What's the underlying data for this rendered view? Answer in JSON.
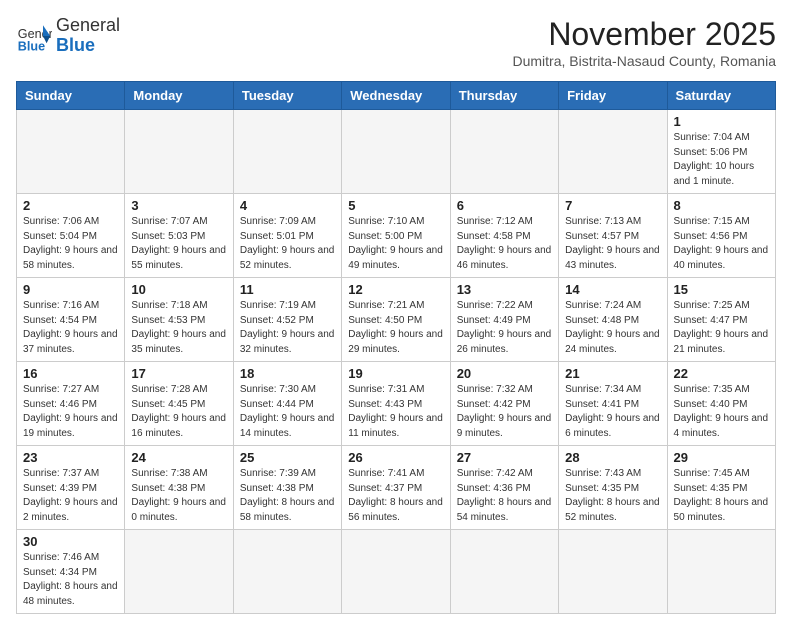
{
  "logo": {
    "general": "General",
    "blue": "Blue"
  },
  "title": "November 2025",
  "subtitle": "Dumitra, Bistrita-Nasaud County, Romania",
  "weekdays": [
    "Sunday",
    "Monday",
    "Tuesday",
    "Wednesday",
    "Thursday",
    "Friday",
    "Saturday"
  ],
  "weeks": [
    [
      {
        "day": "",
        "info": ""
      },
      {
        "day": "",
        "info": ""
      },
      {
        "day": "",
        "info": ""
      },
      {
        "day": "",
        "info": ""
      },
      {
        "day": "",
        "info": ""
      },
      {
        "day": "",
        "info": ""
      },
      {
        "day": "1",
        "info": "Sunrise: 7:04 AM\nSunset: 5:06 PM\nDaylight: 10 hours\nand 1 minute."
      }
    ],
    [
      {
        "day": "2",
        "info": "Sunrise: 7:06 AM\nSunset: 5:04 PM\nDaylight: 9 hours\nand 58 minutes."
      },
      {
        "day": "3",
        "info": "Sunrise: 7:07 AM\nSunset: 5:03 PM\nDaylight: 9 hours\nand 55 minutes."
      },
      {
        "day": "4",
        "info": "Sunrise: 7:09 AM\nSunset: 5:01 PM\nDaylight: 9 hours\nand 52 minutes."
      },
      {
        "day": "5",
        "info": "Sunrise: 7:10 AM\nSunset: 5:00 PM\nDaylight: 9 hours\nand 49 minutes."
      },
      {
        "day": "6",
        "info": "Sunrise: 7:12 AM\nSunset: 4:58 PM\nDaylight: 9 hours\nand 46 minutes."
      },
      {
        "day": "7",
        "info": "Sunrise: 7:13 AM\nSunset: 4:57 PM\nDaylight: 9 hours\nand 43 minutes."
      },
      {
        "day": "8",
        "info": "Sunrise: 7:15 AM\nSunset: 4:56 PM\nDaylight: 9 hours\nand 40 minutes."
      }
    ],
    [
      {
        "day": "9",
        "info": "Sunrise: 7:16 AM\nSunset: 4:54 PM\nDaylight: 9 hours\nand 37 minutes."
      },
      {
        "day": "10",
        "info": "Sunrise: 7:18 AM\nSunset: 4:53 PM\nDaylight: 9 hours\nand 35 minutes."
      },
      {
        "day": "11",
        "info": "Sunrise: 7:19 AM\nSunset: 4:52 PM\nDaylight: 9 hours\nand 32 minutes."
      },
      {
        "day": "12",
        "info": "Sunrise: 7:21 AM\nSunset: 4:50 PM\nDaylight: 9 hours\nand 29 minutes."
      },
      {
        "day": "13",
        "info": "Sunrise: 7:22 AM\nSunset: 4:49 PM\nDaylight: 9 hours\nand 26 minutes."
      },
      {
        "day": "14",
        "info": "Sunrise: 7:24 AM\nSunset: 4:48 PM\nDaylight: 9 hours\nand 24 minutes."
      },
      {
        "day": "15",
        "info": "Sunrise: 7:25 AM\nSunset: 4:47 PM\nDaylight: 9 hours\nand 21 minutes."
      }
    ],
    [
      {
        "day": "16",
        "info": "Sunrise: 7:27 AM\nSunset: 4:46 PM\nDaylight: 9 hours\nand 19 minutes."
      },
      {
        "day": "17",
        "info": "Sunrise: 7:28 AM\nSunset: 4:45 PM\nDaylight: 9 hours\nand 16 minutes."
      },
      {
        "day": "18",
        "info": "Sunrise: 7:30 AM\nSunset: 4:44 PM\nDaylight: 9 hours\nand 14 minutes."
      },
      {
        "day": "19",
        "info": "Sunrise: 7:31 AM\nSunset: 4:43 PM\nDaylight: 9 hours\nand 11 minutes."
      },
      {
        "day": "20",
        "info": "Sunrise: 7:32 AM\nSunset: 4:42 PM\nDaylight: 9 hours\nand 9 minutes."
      },
      {
        "day": "21",
        "info": "Sunrise: 7:34 AM\nSunset: 4:41 PM\nDaylight: 9 hours\nand 6 minutes."
      },
      {
        "day": "22",
        "info": "Sunrise: 7:35 AM\nSunset: 4:40 PM\nDaylight: 9 hours\nand 4 minutes."
      }
    ],
    [
      {
        "day": "23",
        "info": "Sunrise: 7:37 AM\nSunset: 4:39 PM\nDaylight: 9 hours\nand 2 minutes."
      },
      {
        "day": "24",
        "info": "Sunrise: 7:38 AM\nSunset: 4:38 PM\nDaylight: 9 hours\nand 0 minutes."
      },
      {
        "day": "25",
        "info": "Sunrise: 7:39 AM\nSunset: 4:38 PM\nDaylight: 8 hours\nand 58 minutes."
      },
      {
        "day": "26",
        "info": "Sunrise: 7:41 AM\nSunset: 4:37 PM\nDaylight: 8 hours\nand 56 minutes."
      },
      {
        "day": "27",
        "info": "Sunrise: 7:42 AM\nSunset: 4:36 PM\nDaylight: 8 hours\nand 54 minutes."
      },
      {
        "day": "28",
        "info": "Sunrise: 7:43 AM\nSunset: 4:35 PM\nDaylight: 8 hours\nand 52 minutes."
      },
      {
        "day": "29",
        "info": "Sunrise: 7:45 AM\nSunset: 4:35 PM\nDaylight: 8 hours\nand 50 minutes."
      }
    ],
    [
      {
        "day": "30",
        "info": "Sunrise: 7:46 AM\nSunset: 4:34 PM\nDaylight: 8 hours\nand 48 minutes."
      },
      {
        "day": "",
        "info": ""
      },
      {
        "day": "",
        "info": ""
      },
      {
        "day": "",
        "info": ""
      },
      {
        "day": "",
        "info": ""
      },
      {
        "day": "",
        "info": ""
      },
      {
        "day": "",
        "info": ""
      }
    ]
  ]
}
